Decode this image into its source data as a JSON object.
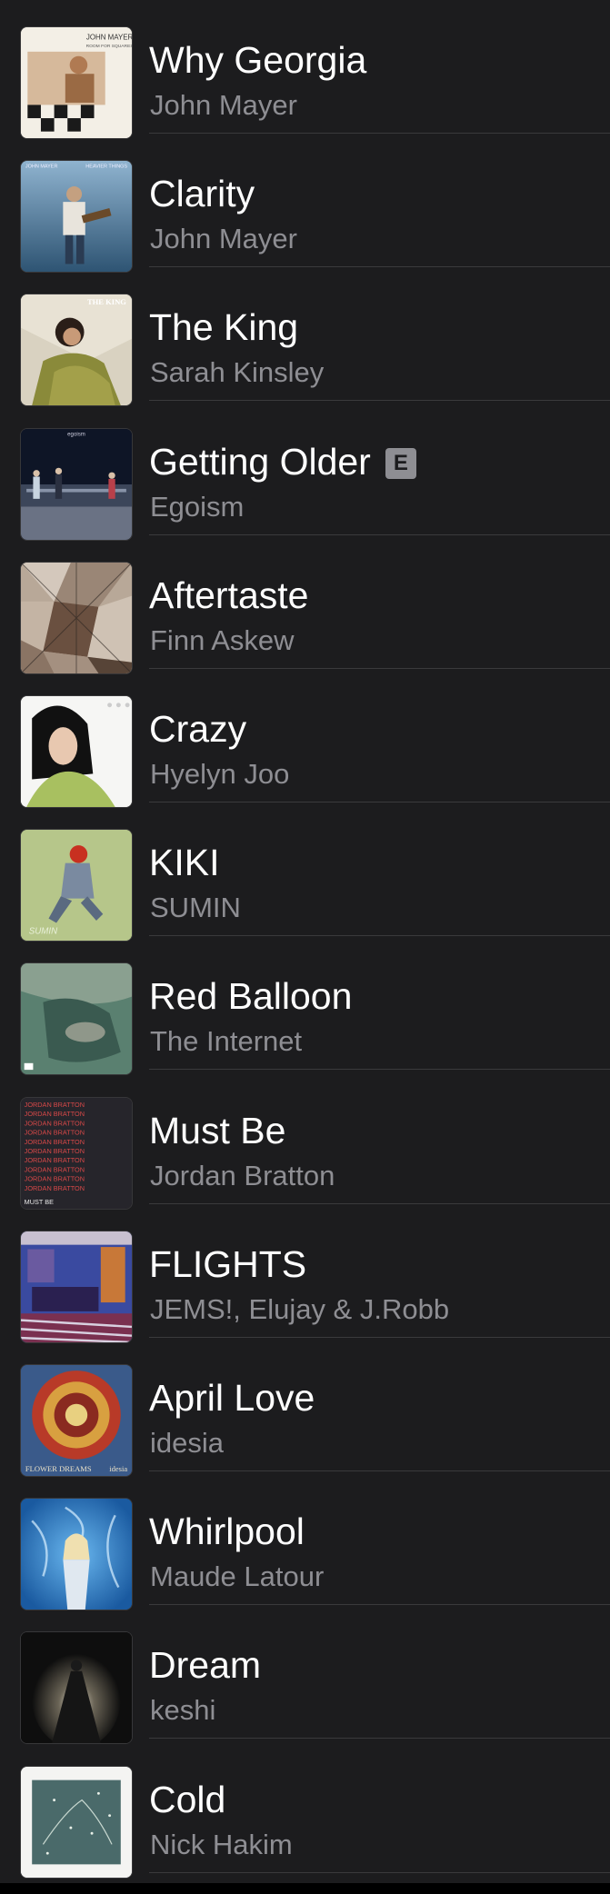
{
  "songs": [
    {
      "title": "Why Georgia",
      "artist": "John Mayer",
      "explicit": false,
      "art": "art-why-georgia"
    },
    {
      "title": "Clarity",
      "artist": "John Mayer",
      "explicit": false,
      "art": "art-clarity"
    },
    {
      "title": "The King",
      "artist": "Sarah Kinsley",
      "explicit": false,
      "art": "art-the-king"
    },
    {
      "title": "Getting Older",
      "artist": "Egoism",
      "explicit": true,
      "art": "art-getting-older"
    },
    {
      "title": "Aftertaste",
      "artist": "Finn Askew",
      "explicit": false,
      "art": "art-aftertaste"
    },
    {
      "title": "Crazy",
      "artist": "Hyelyn Joo",
      "explicit": false,
      "art": "art-crazy"
    },
    {
      "title": "KIKI",
      "artist": "SUMIN",
      "explicit": false,
      "art": "art-kiki"
    },
    {
      "title": "Red Balloon",
      "artist": "The Internet",
      "explicit": false,
      "art": "art-red-balloon"
    },
    {
      "title": "Must Be",
      "artist": "Jordan Bratton",
      "explicit": false,
      "art": "art-must-be"
    },
    {
      "title": "FLIGHTS",
      "artist": "JEMS!, Elujay & J.Robb",
      "explicit": false,
      "art": "art-flights"
    },
    {
      "title": "April Love",
      "artist": "idesia",
      "explicit": false,
      "art": "art-april-love"
    },
    {
      "title": "Whirlpool",
      "artist": "Maude Latour",
      "explicit": false,
      "art": "art-whirlpool"
    },
    {
      "title": "Dream",
      "artist": "keshi",
      "explicit": false,
      "art": "art-dream"
    },
    {
      "title": "Cold",
      "artist": "Nick Hakim",
      "explicit": false,
      "art": "art-cold"
    }
  ],
  "explicit_badge": "E",
  "art_text": {
    "why_georgia_header": "JOHN MAYER",
    "why_georgia_sub": "ROOM FOR SQUARES",
    "clarity_left": "JOHN MAYER",
    "clarity_right": "HEAVIER THINGS",
    "the_king": "THE KING",
    "getting_older": "egoism",
    "kiki": "SUMIN",
    "must_be_line": "JORDAN BRATTON",
    "must_be_footer": "MUST BE",
    "april_love_footer": "FLOWER DREAMS",
    "april_love_artist": "idesia"
  },
  "colors": {
    "background": "#1c1c1e",
    "title": "#ffffff",
    "subtitle": "#8e8e93",
    "divider": "#3a3a3c",
    "badge": "#8e8e93"
  }
}
